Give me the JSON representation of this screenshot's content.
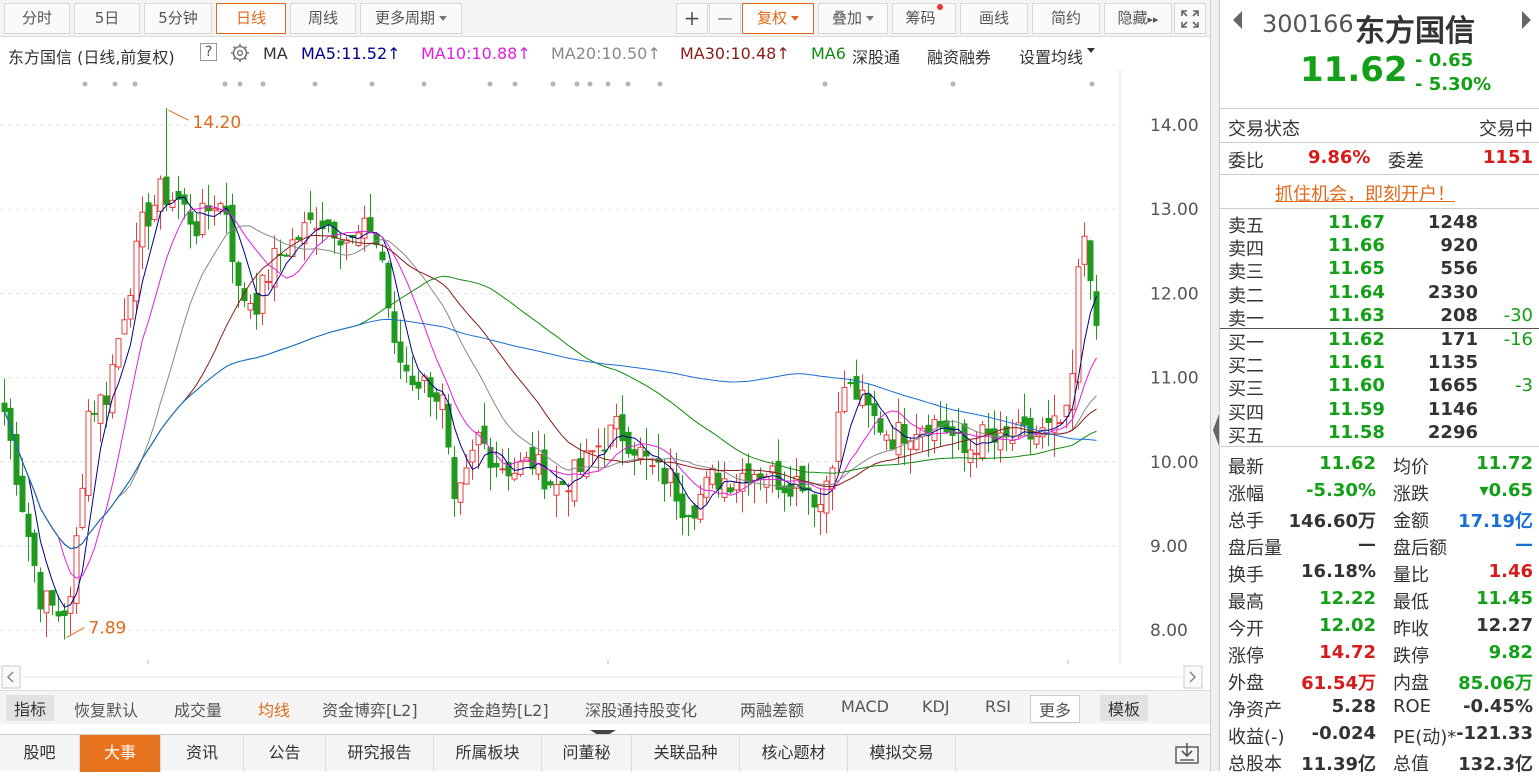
{
  "toolbar": {
    "periods": [
      "分时",
      "5日",
      "5分钟",
      "日线",
      "周线",
      "更多周期"
    ],
    "active_period": "日线",
    "plus": "+",
    "minus": "—",
    "fuquan": "复权",
    "diejia": "叠加",
    "chouma": "筹码",
    "huaxian": "画线",
    "jianyue": "简约",
    "yincang": "隐藏",
    "more_arrows": "▸▸"
  },
  "ma_bar": {
    "title": "东方国信 (日线,前复权)",
    "help": "?",
    "ma": "MA",
    "ma5": "MA5:11.52",
    "ma10": "MA10:10.88",
    "ma20": "MA20:10.50",
    "ma30": "MA30:10.48",
    "ma6x": "MA6",
    "shengu": "深股通",
    "rongzi": "融资融券",
    "setting": "设置均线",
    "arrow": "↑",
    "colors": {
      "ma5": "#00008b",
      "ma10": "#e020e0",
      "ma20": "#888888",
      "ma30": "#8b1a1a",
      "ma60": "#128a12",
      "ma120": "#1a6fd7"
    }
  },
  "chart_data": {
    "type": "candlestick",
    "y_ticks": [
      "14.00",
      "13.00",
      "12.00",
      "11.00",
      "10.00",
      "9.00",
      "8.00"
    ],
    "ylim": [
      7.75,
      14.55
    ],
    "high_label": "14.20",
    "low_label": "7.89",
    "high_value": 14.2,
    "low_value": 7.89,
    "up_color": "#e43f3f",
    "down_color": "#1f9a1f",
    "waypoints": [
      [
        0,
        10.6
      ],
      [
        3,
        9.5
      ],
      [
        6,
        8.4
      ],
      [
        9,
        8.2
      ],
      [
        11,
        8.3
      ],
      [
        14,
        10.6
      ],
      [
        17,
        10.8
      ],
      [
        20,
        11.8
      ],
      [
        23,
        12.8
      ],
      [
        26,
        13.2
      ],
      [
        29,
        13.1
      ],
      [
        32,
        12.8
      ],
      [
        35,
        13.1
      ],
      [
        37,
        13.0
      ],
      [
        39,
        12.0
      ],
      [
        42,
        11.9
      ],
      [
        45,
        12.4
      ],
      [
        48,
        12.6
      ],
      [
        52,
        12.9
      ],
      [
        55,
        12.8
      ],
      [
        58,
        12.6
      ],
      [
        61,
        12.8
      ],
      [
        63,
        12.4
      ],
      [
        65,
        11.3
      ],
      [
        68,
        11.0
      ],
      [
        71,
        10.9
      ],
      [
        73,
        10.7
      ],
      [
        75,
        9.4
      ],
      [
        77,
        9.8
      ],
      [
        79,
        10.3
      ],
      [
        82,
        10.0
      ],
      [
        85,
        9.9
      ],
      [
        88,
        10.0
      ],
      [
        92,
        9.7
      ],
      [
        96,
        9.9
      ],
      [
        99,
        10.2
      ],
      [
        102,
        10.4
      ],
      [
        105,
        10.2
      ],
      [
        108,
        9.9
      ],
      [
        111,
        9.8
      ],
      [
        113,
        9.5
      ],
      [
        115,
        9.5
      ],
      [
        118,
        9.8
      ],
      [
        121,
        9.8
      ],
      [
        124,
        9.9
      ],
      [
        127,
        9.9
      ],
      [
        130,
        9.75
      ],
      [
        133,
        9.8
      ],
      [
        136,
        9.5
      ],
      [
        138,
        10.1
      ],
      [
        140,
        10.9
      ],
      [
        142,
        10.8
      ],
      [
        145,
        10.5
      ],
      [
        148,
        10.3
      ],
      [
        151,
        10.4
      ],
      [
        154,
        10.5
      ],
      [
        157,
        10.4
      ],
      [
        160,
        10.1
      ],
      [
        163,
        10.3
      ],
      [
        166,
        10.2
      ],
      [
        169,
        10.3
      ],
      [
        172,
        10.3
      ],
      [
        175,
        10.4
      ],
      [
        177,
        10.5
      ],
      [
        178,
        11.0
      ],
      [
        179,
        12.2
      ],
      [
        180,
        12.7
      ],
      [
        181,
        12.3
      ],
      [
        182,
        11.62
      ]
    ]
  },
  "tabs_indicator": [
    "指标",
    "恢复默认",
    "成交量",
    "均线",
    "资金博弈[L2]",
    "资金趋势[L2]",
    "深股通持股变化",
    "两融差额",
    "MACD",
    "KDJ",
    "RSI",
    "更多",
    "模板"
  ],
  "tabs_bottom": [
    "股吧",
    "大事",
    "资讯",
    "公告",
    "研究报告",
    "所属板块",
    "问董秘",
    "关联品种",
    "核心题材",
    "模拟交易"
  ],
  "quote": {
    "code": "300166",
    "name": "东方国信",
    "price": "11.62",
    "change": "- 0.65",
    "change_pct": "- 5.30%",
    "status_label": "交易状态",
    "status_value": "交易中",
    "weibi_label": "委比",
    "weibi": "9.86%",
    "weicha_label": "委差",
    "weicha": "1151",
    "promo": "抓住机会，即刻开户！",
    "asks": [
      {
        "label": "卖五",
        "price": "11.67",
        "vol": "1248",
        "delta": ""
      },
      {
        "label": "卖四",
        "price": "11.66",
        "vol": "920",
        "delta": ""
      },
      {
        "label": "卖三",
        "price": "11.65",
        "vol": "556",
        "delta": ""
      },
      {
        "label": "卖二",
        "price": "11.64",
        "vol": "2330",
        "delta": ""
      },
      {
        "label": "卖一",
        "price": "11.63",
        "vol": "208",
        "delta": "-30"
      }
    ],
    "bids": [
      {
        "label": "买一",
        "price": "11.62",
        "vol": "171",
        "delta": "-16"
      },
      {
        "label": "买二",
        "price": "11.61",
        "vol": "1135",
        "delta": ""
      },
      {
        "label": "买三",
        "price": "11.60",
        "vol": "1665",
        "delta": "-3"
      },
      {
        "label": "买四",
        "price": "11.59",
        "vol": "1146",
        "delta": ""
      },
      {
        "label": "买五",
        "price": "11.58",
        "vol": "2296",
        "delta": ""
      }
    ],
    "stats": [
      {
        "l1": "最新",
        "v1": "11.62",
        "c1": "green",
        "l2": "均价",
        "v2": "11.72",
        "c2": "green"
      },
      {
        "l1": "涨幅",
        "v1": "-5.30%",
        "c1": "green",
        "l2": "涨跌",
        "v2": "▾0.65",
        "c2": "green"
      },
      {
        "l1": "总手",
        "v1": "146.60万",
        "c1": "",
        "l2": "金额",
        "v2": "17.19亿",
        "c2": "blue"
      },
      {
        "l1": "盘后量",
        "v1": "—",
        "c1": "",
        "l2": "盘后额",
        "v2": "—",
        "c2": "blue"
      },
      {
        "l1": "换手",
        "v1": "16.18%",
        "c1": "",
        "l2": "量比",
        "v2": "1.46",
        "c2": "red"
      },
      {
        "l1": "最高",
        "v1": "12.22",
        "c1": "green",
        "l2": "最低",
        "v2": "11.45",
        "c2": "green"
      },
      {
        "l1": "今开",
        "v1": "12.02",
        "c1": "green",
        "l2": "昨收",
        "v2": "12.27",
        "c2": ""
      },
      {
        "l1": "涨停",
        "v1": "14.72",
        "c1": "red",
        "l2": "跌停",
        "v2": "9.82",
        "c2": "green"
      },
      {
        "l1": "外盘",
        "v1": "61.54万",
        "c1": "red",
        "l2": "内盘",
        "v2": "85.06万",
        "c2": "green"
      },
      {
        "l1": "净资产",
        "v1": "5.28",
        "c1": "",
        "l2": "ROE",
        "v2": "-0.45%",
        "c2": ""
      },
      {
        "l1": "收益(-)",
        "v1": "-0.024",
        "c1": "",
        "l2": "PE(动)*",
        "v2": "-121.33",
        "c2": ""
      },
      {
        "l1": "总股本",
        "v1": "11.39亿",
        "c1": "",
        "l2": "总值",
        "v2": "132.3亿",
        "c2": ""
      }
    ]
  }
}
